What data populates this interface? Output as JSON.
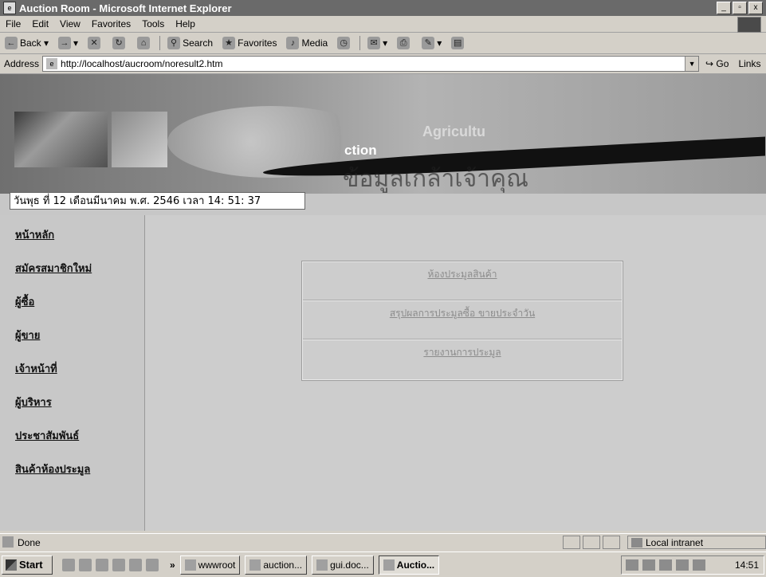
{
  "window": {
    "title": "Auction Room - Microsoft Internet Explorer",
    "buttons": [
      "_",
      "▫",
      "x"
    ]
  },
  "menubar": [
    "File",
    "Edit",
    "View",
    "Favorites",
    "Tools",
    "Help"
  ],
  "toolbar": {
    "back": "Back",
    "search": "Search",
    "favorites": "Favorites",
    "media": "Media"
  },
  "addressbar": {
    "label": "Address",
    "url": "http://localhost/aucroom/noresult2.htm",
    "go": "Go",
    "links": "Links"
  },
  "banner": {
    "brand": "ction",
    "brand2": "Agricultu",
    "thai_watermark": "ข้อมูลเกล้าเจ้าคุณ"
  },
  "datetime": "วันพุธ ที่ 12 เดือนมีนาคม พ.ศ. 2546 เวลา 14: 51: 37",
  "sidebar": {
    "items": [
      "หน้าหลัก",
      "สมัครสมาชิกใหม่",
      "ผู้ซื้อ",
      "ผู้ขาย",
      "เจ้าหน้าที่",
      "ผู้บริหาร",
      "ประชาสัมพันธ์",
      "สินค้าห้องประมูล"
    ]
  },
  "main_menu": [
    "ห้องประมูลสินค้า",
    "สรุปผลการประมูลซื้อ ขายประจำวัน",
    "รายงานการประมูล"
  ],
  "statusbar": {
    "status": "Done",
    "zone": "Local intranet"
  },
  "taskbar": {
    "start": "Start",
    "chevron": "»",
    "tasks": [
      "wwwroot",
      "auction...",
      "gui.doc...",
      "Auctio..."
    ],
    "clock": "14:51"
  }
}
